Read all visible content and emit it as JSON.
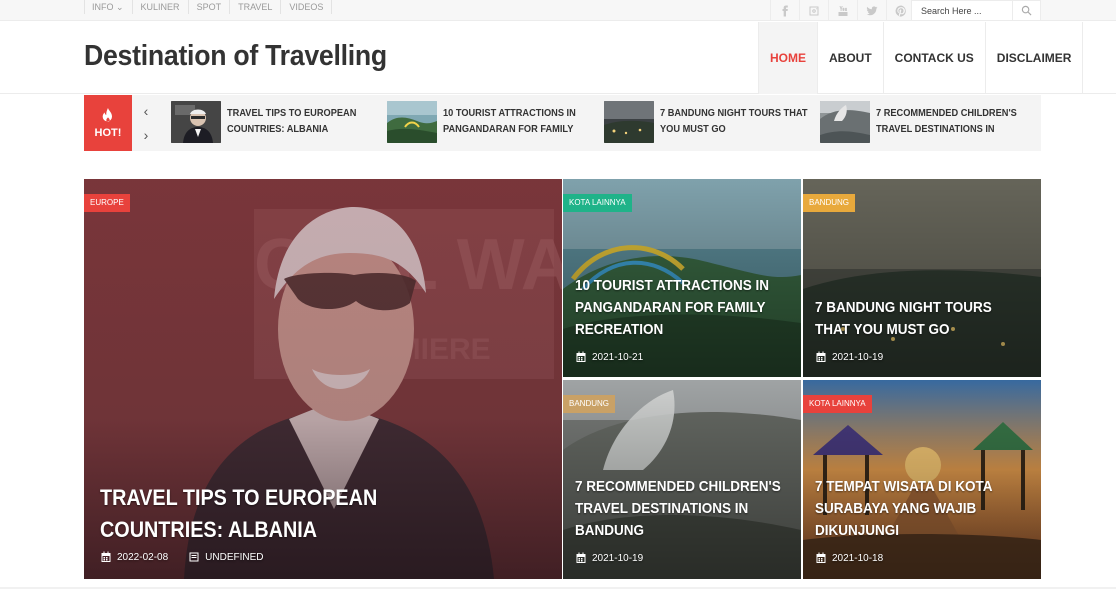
{
  "topnav": {
    "items": [
      "INFO ⌄",
      "KULINER",
      "SPOT",
      "TRAVEL",
      "VIDEOS"
    ]
  },
  "socials": [
    "facebook-icon",
    "instagram-icon",
    "youtube-icon",
    "twitter-icon",
    "pinterest-icon"
  ],
  "search": {
    "placeholder": "Search Here ...",
    "value": ""
  },
  "site": {
    "title": "Destination of Travelling"
  },
  "mainnav": {
    "items": [
      "HOME",
      "ABOUT",
      "CONTACK US",
      "DISCLAIMER"
    ],
    "active_index": 0
  },
  "ticker": {
    "hot_label": "HOT!",
    "prev_arrow": "‹",
    "next_arrow": "›",
    "items": [
      "TRAVEL TIPS TO EUROPEAN COUNTRIES: ALBANIA",
      "10 TOURIST ATTRACTIONS IN PANGANDARAN FOR FAMILY",
      "7 BANDUNG NIGHT TOURS THAT YOU MUST GO",
      "7 RECOMMENDED CHILDREN'S TRAVEL DESTINATIONS IN"
    ]
  },
  "featured": {
    "main": {
      "category": "EUROPE",
      "title": "TRAVEL TIPS TO EUROPEAN COUNTRIES: ALBANIA",
      "date": "2022-02-08",
      "author": "UNDEFINED"
    },
    "cards": [
      {
        "category": "KOTA LAINNYA",
        "title": "10 TOURIST ATTRACTIONS IN PANGANDARAN FOR FAMILY RECREATION",
        "date": "2021-10-21"
      },
      {
        "category": "BANDUNG",
        "title": "7 BANDUNG NIGHT TOURS THAT YOU MUST GO",
        "date": "2021-10-19"
      },
      {
        "category": "BANDUNG",
        "title": "7 RECOMMENDED CHILDREN'S TRAVEL DESTINATIONS IN BANDUNG",
        "date": "2021-10-19"
      },
      {
        "category": "KOTA LAINNYA",
        "title": "7 TEMPAT WISATA DI KOTA SURABAYA YANG WAJIB DIKUNJUNGI",
        "date": "2021-10-18"
      }
    ]
  },
  "colors": {
    "accent": "#e8423c",
    "badge_europe": "#e8423c",
    "badge_kota_lainnya": "#1fb389",
    "badge_bandung": "#e8a93c",
    "badge_bandung_2": "#c9a166",
    "badge_kota_lainnya_2": "#e8423c"
  }
}
